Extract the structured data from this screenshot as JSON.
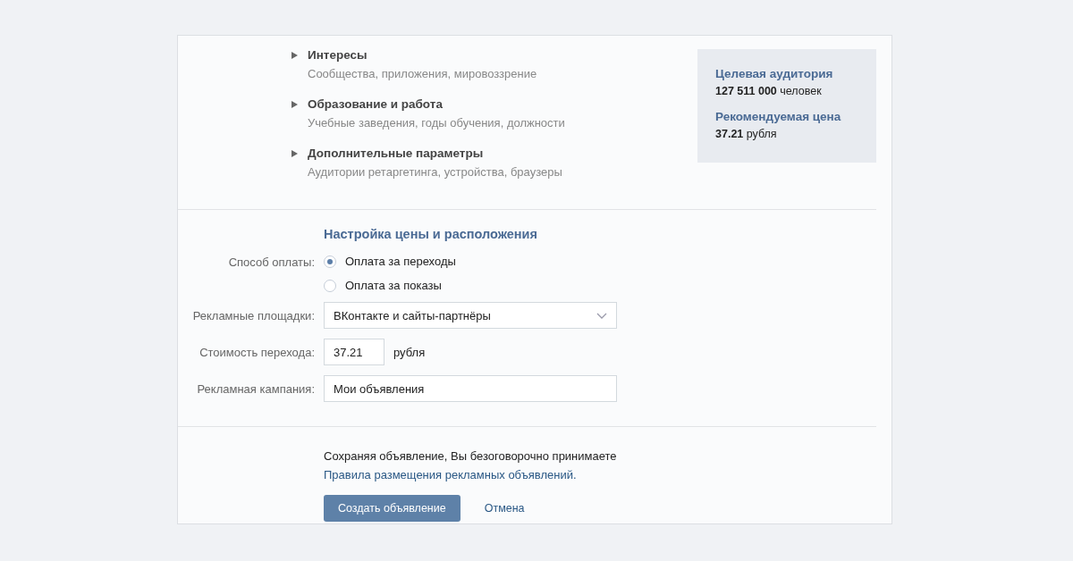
{
  "sections": [
    {
      "title": "Интересы",
      "subtitle": "Сообщества, приложения, мировоззрение",
      "expanded": false
    },
    {
      "title": "Образование и работа",
      "subtitle": "Учебные заведения, годы обучения, должности",
      "expanded": false
    },
    {
      "title": "Дополнительные параметры",
      "subtitle": "Аудитории ретаргетинга, устройства, браузеры",
      "expanded": false
    }
  ],
  "summary": [
    {
      "label": "Целевая аудитория",
      "value": "**127 511 000** человек"
    },
    {
      "label": "Рекомендуемая цена",
      "value": "**37.21** рубля"
    }
  ],
  "price_settings": {
    "title": "Настройка цены и расположения",
    "payment": {
      "label": "Способ оплаты:",
      "options": [
        {
          "label": "Оплата за переходы",
          "selected": true
        },
        {
          "label": "Оплата за показы",
          "selected": false
        }
      ]
    },
    "placements": {
      "label": "Рекламные площадки:",
      "value": "ВКонтакте и сайты-партнёры"
    },
    "cost": {
      "label": "Стоимость перехода:",
      "value": "37.21",
      "unit": "рубля"
    },
    "campaign": {
      "label": "Рекламная кампания:",
      "value": "Мои объявления"
    }
  },
  "footer": {
    "agreement": "Сохраняя объявление, Вы безоговорочно принимаете",
    "rules_link": "Правила размещения рекламных объявлений.",
    "create_button": "Создать объявление",
    "cancel_link": "Отмена"
  }
}
